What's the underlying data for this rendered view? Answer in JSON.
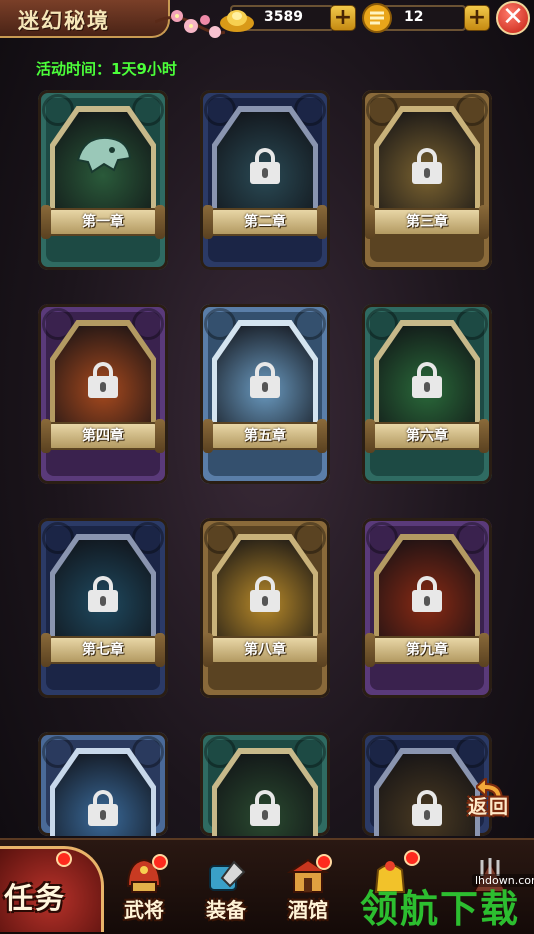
{
  "header": {
    "title": "迷幻秘境",
    "gold": "3589",
    "coupons": "12",
    "plus": "+",
    "close": "✕"
  },
  "activity_time": "活动时间：1天9小时",
  "chapters": [
    {
      "label": "第一章",
      "locked": false
    },
    {
      "label": "第二章",
      "locked": true
    },
    {
      "label": "第三章",
      "locked": true
    },
    {
      "label": "第四章",
      "locked": true
    },
    {
      "label": "第五章",
      "locked": true
    },
    {
      "label": "第六章",
      "locked": true
    },
    {
      "label": "第七章",
      "locked": true
    },
    {
      "label": "第八章",
      "locked": true
    },
    {
      "label": "第九章",
      "locked": true
    },
    {
      "label": "",
      "locked": true
    },
    {
      "label": "",
      "locked": true
    },
    {
      "label": "",
      "locked": true
    }
  ],
  "return_label": "返回",
  "nav": {
    "task": "任务",
    "items": [
      "武将",
      "装备",
      "酒馆",
      "",
      ""
    ]
  },
  "watermark": {
    "text": "领航下载",
    "site": "lhdown.com"
  },
  "colors": {
    "activity": "#4cff3a",
    "badge": "#ff2a1e"
  }
}
